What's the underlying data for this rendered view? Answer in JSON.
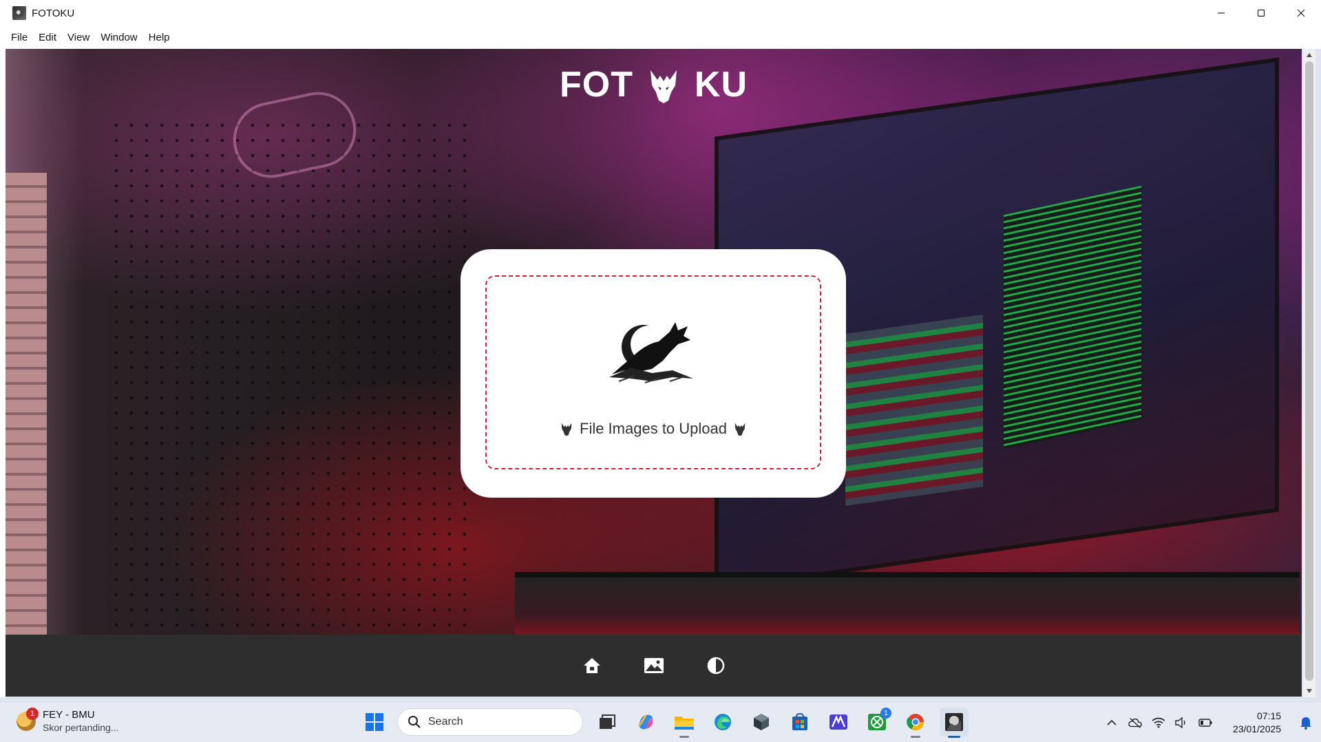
{
  "window": {
    "title": "FOTOKU",
    "controls": [
      "minimize",
      "maximize",
      "close"
    ]
  },
  "menu": {
    "items": [
      "File",
      "Edit",
      "View",
      "Window",
      "Help"
    ]
  },
  "app": {
    "logo_left": "FOT",
    "logo_right": "KU",
    "upload_label": "File Images to Upload",
    "nav": [
      {
        "name": "home",
        "icon": "home-icon"
      },
      {
        "name": "gallery",
        "icon": "image-icon"
      },
      {
        "name": "theme",
        "icon": "contrast-icon"
      }
    ]
  },
  "taskbar": {
    "widget": {
      "badge": "1",
      "title": "FEY - BMU",
      "subtitle": "Skor pertanding..."
    },
    "search_placeholder": "Search",
    "apps": [
      {
        "name": "task-view",
        "icon": "task-view-icon"
      },
      {
        "name": "copilot",
        "icon": "copilot-icon"
      },
      {
        "name": "file-explorer",
        "icon": "folder-icon"
      },
      {
        "name": "edge",
        "icon": "edge-icon"
      },
      {
        "name": "app-cube",
        "icon": "cube-icon"
      },
      {
        "name": "microsoft-store",
        "icon": "store-icon"
      },
      {
        "name": "app-editor",
        "icon": "editor-icon"
      },
      {
        "name": "xbox",
        "icon": "xbox-icon",
        "badge": "1"
      },
      {
        "name": "chrome",
        "icon": "chrome-icon"
      },
      {
        "name": "fotoku",
        "icon": "fotoku-icon"
      }
    ],
    "clock": {
      "time": "07:15",
      "date": "23/01/2025"
    }
  },
  "colors": {
    "accent_dashed": "#cf1d3c",
    "nav_bar": "#2e2e2e",
    "card": "#ffffff"
  }
}
